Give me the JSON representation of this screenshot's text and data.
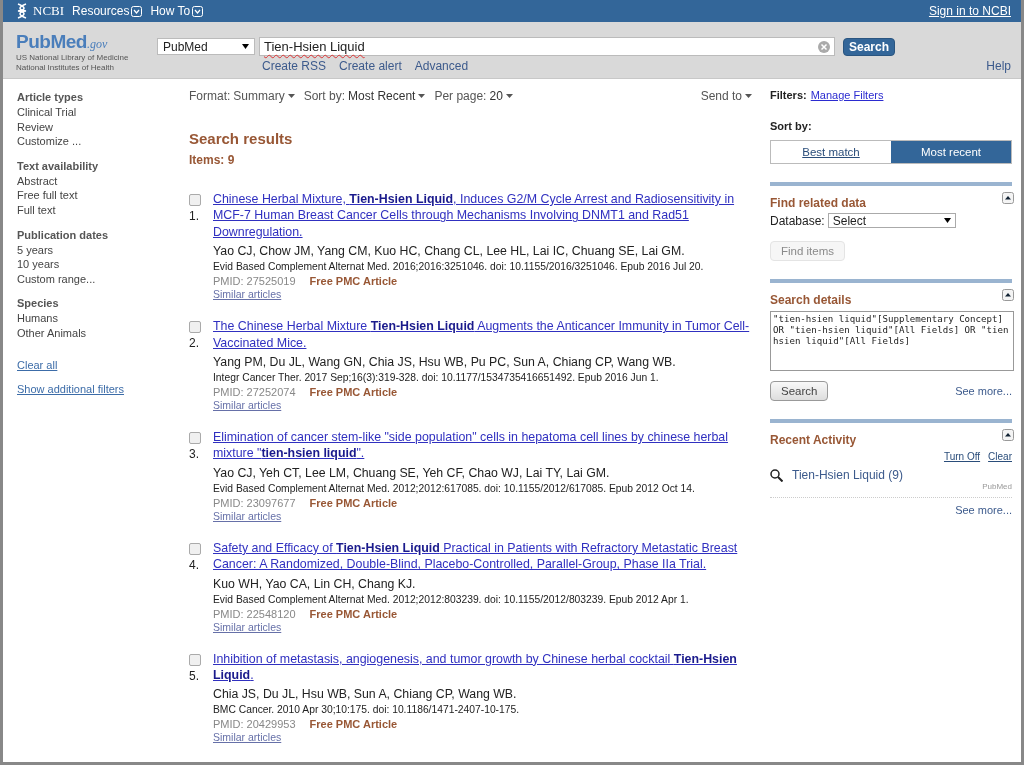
{
  "top_bar": {
    "brand": "NCBI",
    "menus": [
      {
        "label": "Resources"
      },
      {
        "label": "How To"
      }
    ],
    "sign_in": "Sign in to NCBI"
  },
  "search_bar": {
    "logo": "PubMed",
    "logo_suffix": ".gov",
    "logo_lines": [
      "US National Library of Medicine",
      "National Institutes of Health"
    ],
    "database": "PubMed",
    "query": "Tien-Hsien Liquid",
    "button": "Search",
    "links": [
      "Create RSS",
      "Create alert",
      "Advanced"
    ],
    "help": "Help"
  },
  "filters": {
    "groups": [
      {
        "title": "Article types",
        "items": [
          "Clinical Trial",
          "Review",
          "Customize ..."
        ]
      },
      {
        "title": "Text availability",
        "items": [
          "Abstract",
          "Free full text",
          "Full text"
        ]
      },
      {
        "title": "Publication dates",
        "items": [
          "5 years",
          "10 years",
          "Custom range..."
        ]
      },
      {
        "title": "Species",
        "items": [
          "Humans",
          "Other Animals"
        ]
      }
    ],
    "clear": "Clear all",
    "more": "Show additional filters"
  },
  "display": [
    {
      "label": "Format:",
      "value": "Summary"
    },
    {
      "label": "Sort by:",
      "value": "Most Recent"
    },
    {
      "label": "Per page:",
      "value": "20"
    }
  ],
  "send_to": "Send to",
  "results_heading": "Search results",
  "items_count": "Items: 9",
  "results": [
    {
      "number": "1.",
      "checked": false,
      "title": "Chinese Herbal Mixture, **Tien-Hsien Liquid**, Induces G2/M Cycle Arrest and Radiosensitivity in MCF-7 Human Breast Cancer Cells through Mechanisms Involving DNMT1 and Rad51 Downregulation.",
      "authors": "Yao CJ, Chow JM, Yang CM, Kuo HC, Chang CL, Lee HL, Lai IC, Chuang SE, Lai GM.",
      "citation": "Evid Based Complement Alternat Med. 2016;2016:3251046. doi: 10.1155/2016/3251046. Epub 2016 Jul 20.",
      "pmid": "PMID: 27525019",
      "free": "Free PMC Article",
      "similar": "Similar articles"
    },
    {
      "number": "2.",
      "checked": false,
      "title": "The Chinese Herbal Mixture **Tien-Hsien Liquid** Augments the Anticancer Immunity in Tumor Cell-Vaccinated Mice.",
      "authors": "Yang PM, Du JL, Wang GN, Chia JS, Hsu WB, Pu PC, Sun A, Chiang CP, Wang WB.",
      "citation": "Integr Cancer Ther. 2017 Sep;16(3):319-328. doi: 10.1177/1534735416651492. Epub 2016 Jun 1.",
      "pmid": "PMID: 27252074",
      "free": "Free PMC Article",
      "similar": "Similar articles"
    },
    {
      "number": "3.",
      "checked": false,
      "title": "Elimination of cancer stem-like \"side population\" cells in hepatoma cell lines by chinese herbal mixture \"**tien-hsien liquid**\".",
      "authors": "Yao CJ, Yeh CT, Lee LM, Chuang SE, Yeh CF, Chao WJ, Lai TY, Lai GM.",
      "citation": "Evid Based Complement Alternat Med. 2012;2012:617085. doi: 10.1155/2012/617085. Epub 2012 Oct 14.",
      "pmid": "PMID: 23097677",
      "free": "Free PMC Article",
      "similar": "Similar articles"
    },
    {
      "number": "4.",
      "checked": false,
      "title": "Safety and Efficacy of **Tien-Hsien Liquid** Practical in Patients with Refractory Metastatic Breast Cancer: A Randomized, Double-Blind, Placebo-Controlled, Parallel-Group, Phase IIa Trial.",
      "authors": "Kuo WH, Yao CA, Lin CH, Chang KJ.",
      "citation": "Evid Based Complement Alternat Med. 2012;2012:803239. doi: 10.1155/2012/803239. Epub 2012 Apr 1.",
      "pmid": "PMID: 22548120",
      "free": "Free PMC Article",
      "similar": "Similar articles"
    },
    {
      "number": "5.",
      "checked": false,
      "title": "Inhibition of metastasis, angiogenesis, and tumor growth by Chinese herbal cocktail **Tien-Hsien Liquid**.",
      "authors": "Chia JS, Du JL, Hsu WB, Sun A, Chiang CP, Wang WB.",
      "citation": "BMC Cancer. 2010 Apr 30;10:175. doi: 10.1186/1471-2407-10-175.",
      "pmid": "PMID: 20429953",
      "free": "Free PMC Article",
      "similar": "Similar articles"
    }
  ],
  "sidebar": {
    "filters_label": "Filters:",
    "manage_filters": "Manage Filters",
    "sort_label": "Sort by:",
    "sort_options": [
      {
        "label": "Best match",
        "selected": false
      },
      {
        "label": "Most recent",
        "selected": true
      }
    ],
    "find_related": {
      "title": "Find related data",
      "database_label": "Database:",
      "database": "Select",
      "button": "Find items",
      "button_disabled": true
    },
    "search_details": {
      "title": "Search details",
      "query": "\"tien-hsien liquid\"[Supplementary Concept] OR \"tien-hsien liquid\"[All Fields] OR \"tien hsien liquid\"[All Fields]",
      "button": "Search",
      "see_more": "See more..."
    },
    "recent_activity": {
      "title": "Recent Activity",
      "actions": [
        "Turn Off",
        "Clear"
      ],
      "items": [
        {
          "label": "Tien-Hsien Liquid (9)",
          "database": "PubMed"
        }
      ],
      "see_more": "See more..."
    }
  }
}
